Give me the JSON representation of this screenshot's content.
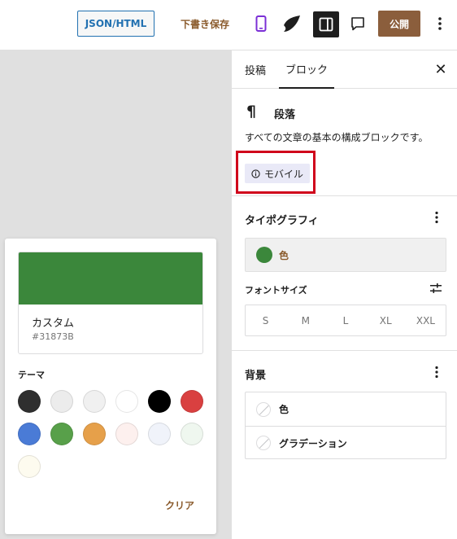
{
  "topbar": {
    "json_label": "JSON/HTML",
    "draft_label": "下書き保存",
    "publish_label": "公開",
    "icons": [
      "mobile-icon",
      "logo-icon",
      "sidebar-toggle-icon",
      "comment-icon",
      "more-vertical-icon"
    ]
  },
  "popover": {
    "swatch_name": "カスタム",
    "swatch_hex": "#31873B",
    "swatch_color": "#3b873b",
    "theme_label": "テーマ",
    "colors": [
      "#2f2f2f",
      "#ececec",
      "#f0f0f0",
      "#ffffff",
      "#000000",
      "#d94040",
      "#4a7bd6",
      "#58a04a",
      "#e6a04a",
      "#fdf0ee",
      "#f0f3fa",
      "#eff7ef",
      "#fdfbef"
    ],
    "clear_label": "クリア"
  },
  "sidebar": {
    "tab_post": "投稿",
    "tab_block": "ブロック",
    "block_icon": "¶",
    "block_title": "段落",
    "block_desc": "すべての文章の基本の構成ブロックです。",
    "badge_label": "モバイル",
    "typography_title": "タイポグラフィ",
    "color_label": "色",
    "color_value": "#3b873b",
    "font_size_label": "フォントサイズ",
    "font_sizes": [
      "S",
      "M",
      "L",
      "XL",
      "XXL"
    ],
    "background_title": "背景",
    "bg_color_label": "色",
    "bg_gradient_label": "グラデーション"
  }
}
